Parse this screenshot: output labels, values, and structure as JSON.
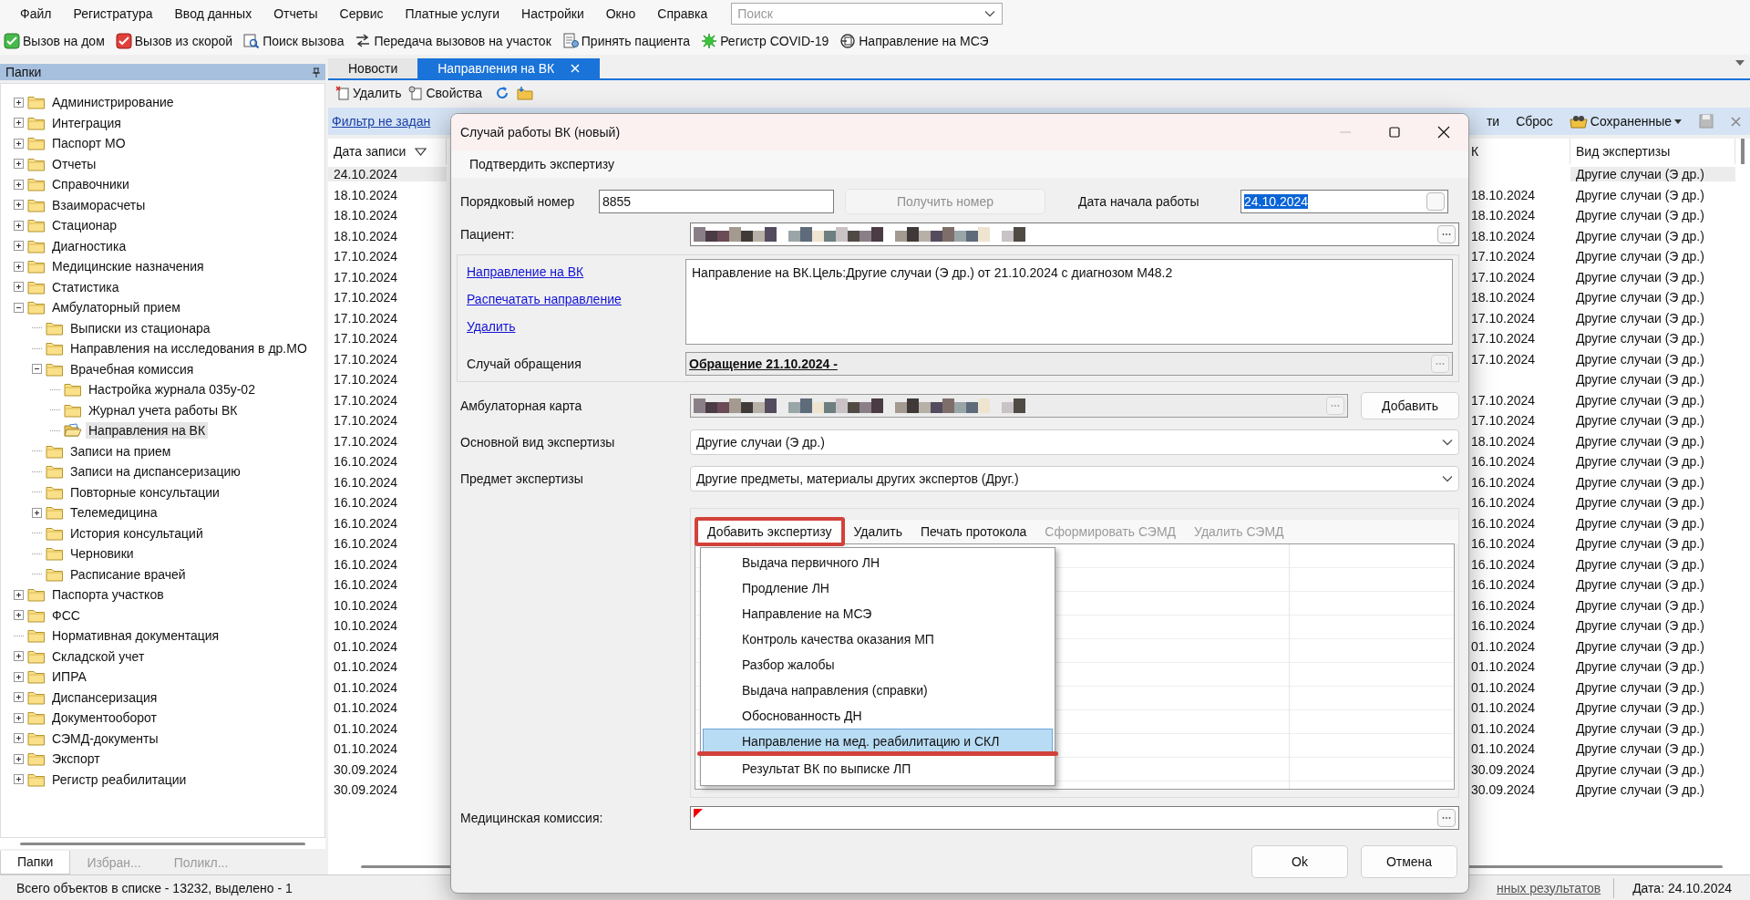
{
  "menu": [
    "Файл",
    "Регистратура",
    "Ввод данных",
    "Отчеты",
    "Сервис",
    "Платные услуги",
    "Настройки",
    "Окно",
    "Справка"
  ],
  "search": {
    "placeholder": "Поиск"
  },
  "toolbar": [
    {
      "label": "Вызов на дом",
      "kind": "home"
    },
    {
      "label": "Вызов из скорой",
      "kind": "ambulance"
    },
    {
      "label": "Поиск вызова",
      "kind": "search"
    },
    {
      "label": "Передача вызовов на участок",
      "kind": "transfer"
    },
    {
      "label": "Принять пациента",
      "kind": "accept"
    },
    {
      "label": "Регистр COVID-19",
      "kind": "virus"
    },
    {
      "label": "Направление на МСЭ",
      "kind": "referral"
    }
  ],
  "sidebar": {
    "title": "Папки",
    "tree": [
      {
        "label": "Администрирование",
        "kind": "node",
        "expanded": false,
        "selected": false
      },
      {
        "label": "Интеграция",
        "kind": "node",
        "expanded": false,
        "selected": false
      },
      {
        "label": "Паспорт МО",
        "kind": "node",
        "expanded": false,
        "selected": false
      },
      {
        "label": "Отчеты",
        "kind": "node",
        "expanded": false,
        "selected": false
      },
      {
        "label": "Справочники",
        "kind": "node",
        "expanded": false,
        "selected": false
      },
      {
        "label": "Взаиморасчеты",
        "kind": "node",
        "expanded": false,
        "selected": false
      },
      {
        "label": "Стационар",
        "kind": "node",
        "expanded": false,
        "selected": false
      },
      {
        "label": "Диагностика",
        "kind": "node",
        "expanded": false,
        "selected": false
      },
      {
        "label": "Медицинские назначения",
        "kind": "node",
        "expanded": false,
        "selected": false
      },
      {
        "label": "Статистика",
        "kind": "node",
        "expanded": false,
        "selected": false
      },
      {
        "label": "Амбулаторный прием",
        "kind": "node",
        "expanded": true,
        "selected": false,
        "children": [
          {
            "label": "Выписки из стационара",
            "kind": "leaf",
            "selected": false
          },
          {
            "label": "Направления на исследования в др.МО",
            "kind": "leaf",
            "selected": false
          },
          {
            "label": "Врачебная комиссия",
            "kind": "node",
            "expanded": true,
            "selected": false,
            "children": [
              {
                "label": "Настройка журнала 035у-02",
                "kind": "leaf",
                "selected": false
              },
              {
                "label": "Журнал учета работы ВК",
                "kind": "leaf",
                "selected": false
              },
              {
                "label": "Направления на ВК",
                "kind": "leaf",
                "selected": true
              }
            ]
          },
          {
            "label": "Записи на прием",
            "kind": "leaf",
            "selected": false
          },
          {
            "label": "Записи на диспансеризацию",
            "kind": "leaf",
            "selected": false
          },
          {
            "label": "Повторные консультации",
            "kind": "leaf",
            "selected": false
          },
          {
            "label": "Телемедицина",
            "kind": "node",
            "expanded": false,
            "selected": false
          },
          {
            "label": "История консультаций",
            "kind": "leaf",
            "selected": false
          },
          {
            "label": "Черновики",
            "kind": "leaf",
            "selected": false
          },
          {
            "label": "Расписание врачей",
            "kind": "leaf",
            "selected": false
          }
        ]
      },
      {
        "label": "Паспорта участков",
        "kind": "node",
        "expanded": false,
        "selected": false
      },
      {
        "label": "ФСС",
        "kind": "node",
        "expanded": false,
        "selected": false
      },
      {
        "label": "Нормативная документация",
        "kind": "leaf",
        "selected": false
      },
      {
        "label": "Складской учет",
        "kind": "node",
        "expanded": false,
        "selected": false
      },
      {
        "label": "ИПРА",
        "kind": "node",
        "expanded": false,
        "selected": false
      },
      {
        "label": "Диспансеризация",
        "kind": "node",
        "expanded": false,
        "selected": false
      },
      {
        "label": "Документооборот",
        "kind": "node",
        "expanded": false,
        "selected": false
      },
      {
        "label": "СЭМД-документы",
        "kind": "node",
        "expanded": false,
        "selected": false
      },
      {
        "label": "Экспорт",
        "kind": "node",
        "expanded": false,
        "selected": false
      },
      {
        "label": "Регистр реабилитации",
        "kind": "node",
        "expanded": false,
        "selected": false
      }
    ],
    "tabs": [
      {
        "label": "Папки",
        "selected": true
      },
      {
        "label": "Избран...",
        "selected": false
      },
      {
        "label": "Поликл...",
        "selected": false
      }
    ]
  },
  "tabs": [
    {
      "label": "Новости",
      "selected": false,
      "closable": false
    },
    {
      "label": "Направления на ВК",
      "selected": true,
      "closable": true
    }
  ],
  "list_toolbar": [
    {
      "label": "Удалить",
      "kind": "delete"
    },
    {
      "label": "Свойства",
      "kind": "properties"
    },
    {
      "kind": "refresh"
    },
    {
      "kind": "folder"
    }
  ],
  "filter_bar": {
    "link": "Фильтр не задан",
    "items": [
      {
        "label": "ти",
        "kind": "text"
      },
      {
        "label": "Сброс",
        "kind": "text"
      },
      {
        "label": "Сохраненные",
        "kind": "dropdown"
      },
      {
        "kind": "save"
      },
      {
        "kind": "close"
      }
    ]
  },
  "table": {
    "columns": [
      {
        "label": "Дата записи",
        "sorted": true
      },
      {
        "label": "К",
        "sorted": false
      },
      {
        "label": "Вид экспертизы",
        "sorted": false
      }
    ],
    "rows": [
      {
        "date": "24.10.2024",
        "type": "Другие случаи (Э др.)",
        "selected": true
      },
      {
        "date": "18.10.2024",
        "column_2": "18.10.2024",
        "type": "Другие случаи (Э др.)",
        "selected": false
      },
      {
        "date": "18.10.2024",
        "column_2": "18.10.2024",
        "type": "Другие случаи (Э др.)",
        "selected": false
      },
      {
        "date": "18.10.2024",
        "column_2": "18.10.2024",
        "type": "Другие случаи (Э др.)",
        "selected": false
      },
      {
        "date": "17.10.2024",
        "column_2": "17.10.2024",
        "type": "Другие случаи (Э др.)",
        "selected": false
      },
      {
        "date": "17.10.2024",
        "column_2": "17.10.2024",
        "type": "Другие случаи (Э др.)",
        "selected": false
      },
      {
        "date": "17.10.2024",
        "column_2": "18.10.2024",
        "type": "Другие случаи (Э др.)",
        "selected": false
      },
      {
        "date": "17.10.2024",
        "column_2": "17.10.2024",
        "type": "Другие случаи (Э др.)",
        "selected": false
      },
      {
        "date": "17.10.2024",
        "column_2": "17.10.2024",
        "type": "Другие случаи (Э др.)",
        "selected": false
      },
      {
        "date": "17.10.2024",
        "column_2": "17.10.2024",
        "type": "Другие случаи (Э др.)",
        "selected": false
      },
      {
        "date": "17.10.2024",
        "type": "Другие случаи (Э др.)",
        "selected": false
      },
      {
        "date": "17.10.2024",
        "column_2": "17.10.2024",
        "type": "Другие случаи (Э др.)",
        "selected": false
      },
      {
        "date": "17.10.2024",
        "column_2": "17.10.2024",
        "type": "Другие случаи (Э др.)",
        "selected": false
      },
      {
        "date": "17.10.2024",
        "column_2": "18.10.2024",
        "type": "Другие случаи (Э др.)",
        "selected": false
      },
      {
        "date": "16.10.2024",
        "column_2": "16.10.2024",
        "type": "Другие случаи (Э др.)",
        "selected": false
      },
      {
        "date": "16.10.2024",
        "column_2": "16.10.2024",
        "type": "Другие случаи (Э др.)",
        "selected": false
      },
      {
        "date": "16.10.2024",
        "column_2": "16.10.2024",
        "type": "Другие случаи (Э др.)",
        "selected": false
      },
      {
        "date": "16.10.2024",
        "column_2": "16.10.2024",
        "type": "Другие случаи (Э др.)",
        "selected": false
      },
      {
        "date": "16.10.2024",
        "column_2": "16.10.2024",
        "type": "Другие случаи (Э др.)",
        "selected": false
      },
      {
        "date": "16.10.2024",
        "column_2": "16.10.2024",
        "type": "Другие случаи (Э др.)",
        "selected": false
      },
      {
        "date": "16.10.2024",
        "column_2": "16.10.2024",
        "type": "Другие случаи (Э др.)",
        "selected": false
      },
      {
        "date": "10.10.2024",
        "column_2": "16.10.2024",
        "type": "Другие случаи (Э др.)",
        "selected": false
      },
      {
        "date": "10.10.2024",
        "column_2": "16.10.2024",
        "type": "Другие случаи (Э др.)",
        "selected": false
      },
      {
        "date": "01.10.2024",
        "column_2": "01.10.2024",
        "type": "Другие случаи (Э др.)",
        "selected": false
      },
      {
        "date": "01.10.2024",
        "column_2": "01.10.2024",
        "type": "Другие случаи (Э др.)",
        "selected": false
      },
      {
        "date": "01.10.2024",
        "column_2": "01.10.2024",
        "type": "Другие случаи (Э др.)",
        "selected": false
      },
      {
        "date": "01.10.2024",
        "column_2": "01.10.2024",
        "type": "Другие случаи (Э др.)",
        "selected": false
      },
      {
        "date": "01.10.2024",
        "column_2": "01.10.2024",
        "type": "Другие случаи (Э др.)",
        "selected": false
      },
      {
        "date": "01.10.2024",
        "column_2": "01.10.2024",
        "type": "Другие случаи (Э др.)",
        "selected": false
      },
      {
        "date": "30.09.2024",
        "column_2": "30.09.2024",
        "type": "Другие случаи (Э др.)",
        "selected": false
      },
      {
        "date": "30.09.2024",
        "column_2": "30.09.2024",
        "type": "Другие случаи (Э др.)",
        "selected": false
      }
    ]
  },
  "status_bar": {
    "text": "Всего объектов в списке - 13232, выделено - 1",
    "link": "нных результатов",
    "date": "Дата: 24.10.2024"
  },
  "dialog": {
    "title": "Случай работы ВК (новый)",
    "menu": "Подтвердить экспертизу",
    "number": {
      "label": "Порядковый номер",
      "value": "8855"
    },
    "get_number": {
      "label": "Получить номер",
      "disabled": true
    },
    "start_date": {
      "label": "Дата начала работы",
      "value": "24.10.2024",
      "text_selected": true
    },
    "patient": {
      "label": "Пациент:"
    },
    "links": [
      "Направление на ВК",
      "Распечатать направление",
      "Удалить"
    ],
    "referral_text": "Направление на ВК.Цель:Другие случаи (Э др.) от 21.10.2024 с диагнозом М48.2",
    "case": {
      "label": "Случай обращения",
      "value": "Обращение 21.10.2024 -"
    },
    "card": {
      "label": "Амбулаторная карта",
      "button": "Добавить"
    },
    "main_type": {
      "label": "Основной вид экспертизы",
      "value": "Другие случаи (Э др.)"
    },
    "subject": {
      "label": "Предмет экспертизы",
      "value": "Другие предметы, материалы других экспертов (Друг.)"
    },
    "panel_toolbar": [
      {
        "label": "Добавить экспертизу",
        "disabled": false,
        "annotated": true
      },
      {
        "label": "Удалить",
        "disabled": false,
        "annotated": false
      },
      {
        "label": "Печать протокола",
        "disabled": false,
        "annotated": false
      },
      {
        "label": "Сформировать СЭМД",
        "disabled": true,
        "annotated": false
      },
      {
        "label": "Удалить СЭМД",
        "disabled": true,
        "annotated": false
      }
    ],
    "dropdown": [
      {
        "label": "Выдача первичного ЛН",
        "selected": false,
        "annotated": false
      },
      {
        "label": "Продление ЛН",
        "selected": false,
        "annotated": false
      },
      {
        "label": "Направление на МСЭ",
        "selected": false,
        "annotated": false
      },
      {
        "label": "Контроль качества оказания МП",
        "selected": false,
        "annotated": false
      },
      {
        "label": "Разбор жалобы",
        "selected": false,
        "annotated": false
      },
      {
        "label": "Выдача направления (справки)",
        "selected": false,
        "annotated": false
      },
      {
        "label": "Обоснованность ДН",
        "selected": false,
        "annotated": false
      },
      {
        "label": "Направление на мед. реабилитацию и СКЛ",
        "selected": true,
        "annotated": true
      },
      {
        "label": "Результат ВК по выписке ЛП",
        "selected": false,
        "annotated": false
      }
    ],
    "commission": {
      "label": "Медицинская комиссия:",
      "required": true
    },
    "buttons": [
      {
        "label": "Ok"
      },
      {
        "label": "Отмена"
      }
    ]
  }
}
